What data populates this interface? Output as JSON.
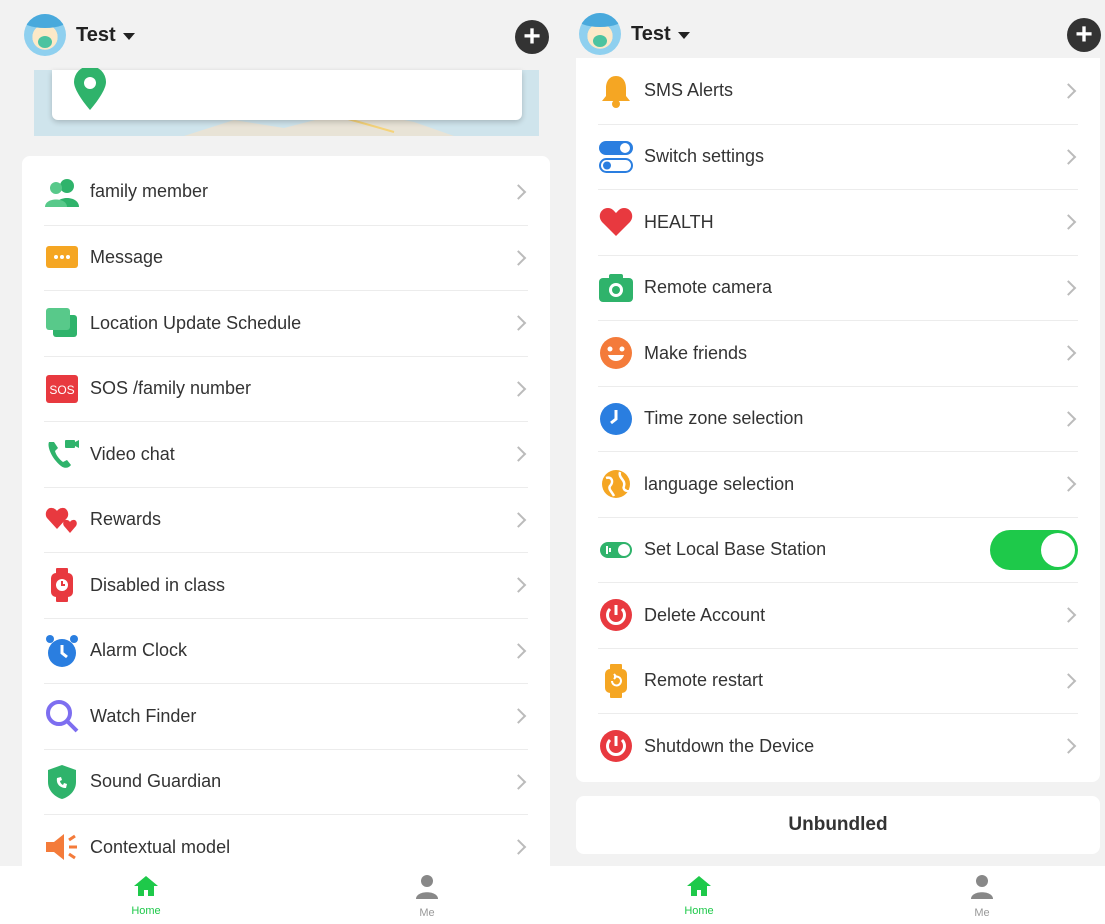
{
  "left": {
    "header": {
      "name": "Test"
    },
    "menu": [
      {
        "label": "family member",
        "icon": "family-member-icon"
      },
      {
        "label": "Message",
        "icon": "message-icon"
      },
      {
        "label": "Location Update Schedule",
        "icon": "location-schedule-icon"
      },
      {
        "label": "SOS /family number",
        "icon": "sos-icon",
        "badge": "SOS"
      },
      {
        "label": "Video chat",
        "icon": "video-chat-icon"
      },
      {
        "label": "Rewards",
        "icon": "rewards-icon"
      },
      {
        "label": "Disabled in class",
        "icon": "disabled-in-class-icon"
      },
      {
        "label": "Alarm Clock",
        "icon": "alarm-clock-icon"
      },
      {
        "label": "Watch Finder",
        "icon": "watch-finder-icon"
      },
      {
        "label": "Sound Guardian",
        "icon": "sound-guardian-icon"
      },
      {
        "label": "Contextual model",
        "icon": "contextual-model-icon"
      }
    ],
    "tabs": [
      {
        "label": "Home",
        "active": true
      },
      {
        "label": "Me",
        "active": false
      }
    ]
  },
  "right": {
    "header": {
      "name": "Test"
    },
    "menu": [
      {
        "label": "SMS Alerts",
        "icon": "bell-icon"
      },
      {
        "label": "Switch settings",
        "icon": "switch-settings-icon"
      },
      {
        "label": "HEALTH",
        "icon": "heart-icon"
      },
      {
        "label": "Remote camera",
        "icon": "camera-icon"
      },
      {
        "label": "Make friends",
        "icon": "smiley-icon"
      },
      {
        "label": "Time zone selection",
        "icon": "clock-icon"
      },
      {
        "label": "language selection",
        "icon": "globe-icon"
      },
      {
        "label": "Set Local Base Station",
        "icon": "base-station-icon",
        "toggle": true
      },
      {
        "label": "Delete Account",
        "icon": "power-icon"
      },
      {
        "label": "Remote restart",
        "icon": "restart-icon"
      },
      {
        "label": "Shutdown the Device",
        "icon": "power-icon"
      }
    ],
    "unbundled": "Unbundled",
    "tabs": [
      {
        "label": "Home",
        "active": true
      },
      {
        "label": "Me",
        "active": false
      }
    ]
  },
  "colors": {
    "accent": "#1ec94a",
    "inactive": "#999999"
  }
}
